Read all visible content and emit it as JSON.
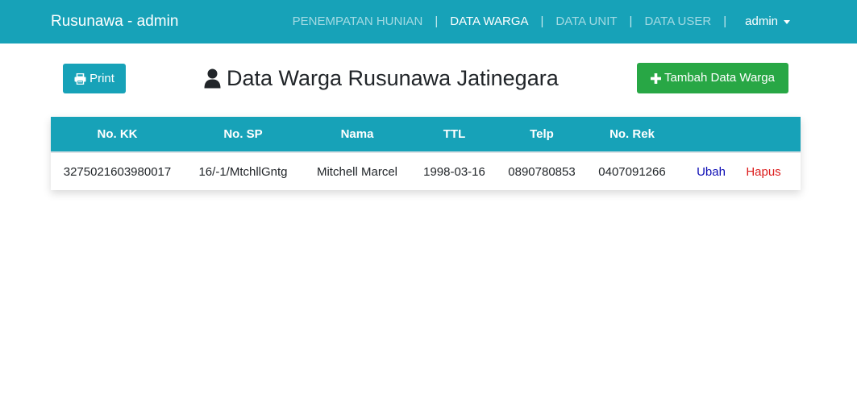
{
  "navbar": {
    "brand": "Rusunawa - admin",
    "links": [
      {
        "label": "PENEMPATAN HUNIAN"
      },
      {
        "label": "DATA WARGA"
      },
      {
        "label": "DATA UNIT"
      },
      {
        "label": "DATA USER"
      }
    ],
    "separator": "|",
    "user": "admin",
    "color": "#17a2b8"
  },
  "toolbar": {
    "print_label": "Print",
    "add_label": "Tambah Data Warga"
  },
  "page": {
    "title": "Data Warga Rusunawa Jatinegara"
  },
  "table": {
    "columns": [
      "No. KK",
      "No. SP",
      "Nama",
      "TTL",
      "Telp",
      "No. Rek"
    ],
    "rows": [
      {
        "cells": [
          "3275021603980017",
          "16/-1/MtchllGntg",
          "Mitchell Marcel",
          "1998-03-16",
          "0890780853",
          "0407091266"
        ],
        "edit_label": "Ubah",
        "delete_label": "Hapus"
      }
    ]
  },
  "icons": {
    "print": "printer-icon",
    "add": "plus-icon",
    "title": "user-icon",
    "user_menu": "caret-down-icon"
  },
  "colors": {
    "primary": "#17a2b8",
    "success": "#28a745",
    "edit_link": "#0b0bb4",
    "delete_link": "#dc1c1c"
  }
}
